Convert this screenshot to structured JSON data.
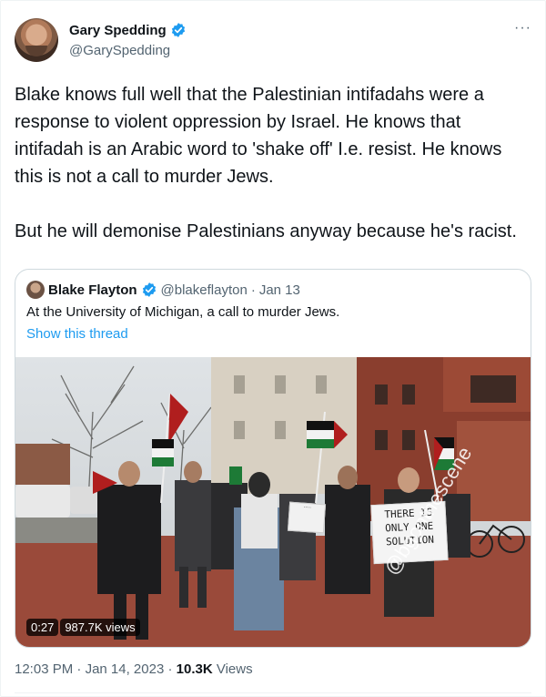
{
  "author": {
    "display_name": "Gary Spedding",
    "handle": "@GarySpedding",
    "verified_icon": "verified-badge-icon"
  },
  "more_icon": "more-icon",
  "more_label": "···",
  "tweet": {
    "text": "Blake knows full well that the Palestinian intifadahs were a response to violent oppression by Israel. He knows that intifadah is an Arabic word to 'shake off' I.e. resist. He knows this is not a call to murder Jews.\n\nBut he will demonise Palestinians anyway because he's racist."
  },
  "quoted": {
    "display_name": "Blake Flayton",
    "handle": "@blakeflayton",
    "separator": "·",
    "date": "Jan 13",
    "text": "At the University of Michigan, a call to murder Jews.",
    "show_thread": "Show this thread",
    "video": {
      "duration": "0:27",
      "views": "987.7K views",
      "watermark": "@bgonthescene",
      "sign_text": "THERE IS ONLY ONE SOLUTION",
      "sign2_text": "....."
    }
  },
  "footer": {
    "time": "12:03 PM",
    "separator": "·",
    "date": "Jan 14, 2023",
    "views_count": "10.3K",
    "views_label": "Views"
  },
  "colors": {
    "text": "#0f1419",
    "secondary": "#536471",
    "accent": "#1d9bf0",
    "border": "#cfd9de"
  }
}
